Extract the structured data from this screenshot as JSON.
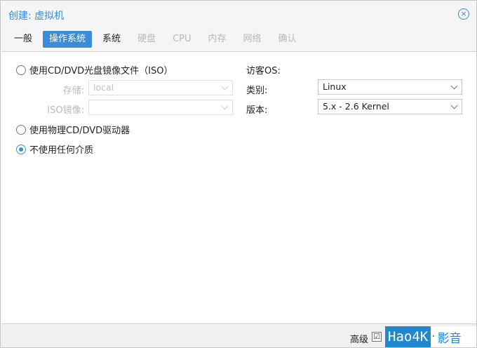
{
  "dialog": {
    "title": "创建: 虚拟机",
    "close_icon": "×"
  },
  "tabs": [
    {
      "label": "一般",
      "state": "normal"
    },
    {
      "label": "操作系统",
      "state": "active"
    },
    {
      "label": "系统",
      "state": "normal"
    },
    {
      "label": "硬盘",
      "state": "disabled"
    },
    {
      "label": "CPU",
      "state": "disabled"
    },
    {
      "label": "内存",
      "state": "disabled"
    },
    {
      "label": "网络",
      "state": "disabled"
    },
    {
      "label": "确认",
      "state": "disabled"
    }
  ],
  "media": {
    "option_iso": "使用CD/DVD光盘镜像文件（ISO）",
    "storage_label": "存储:",
    "storage_value": "local",
    "iso_label": "ISO镜像:",
    "iso_value": "",
    "option_physical": "使用物理CD/DVD驱动器",
    "option_none": "不使用任何介质",
    "selected": "option_none"
  },
  "guest_os": {
    "heading": "访客OS:",
    "type_label": "类别:",
    "type_value": "Linux",
    "version_label": "版本:",
    "version_value": "5.x - 2.6 Kernel"
  },
  "footer": {
    "advanced_label": "高级",
    "advanced_checked": true,
    "advanced_check_glyph": "☑"
  },
  "watermark": {
    "box_text": "Hao4K",
    "dot": "·",
    "text": "影音"
  },
  "colors": {
    "accent": "#3a8bd8",
    "watermark": "#1f88cf"
  }
}
